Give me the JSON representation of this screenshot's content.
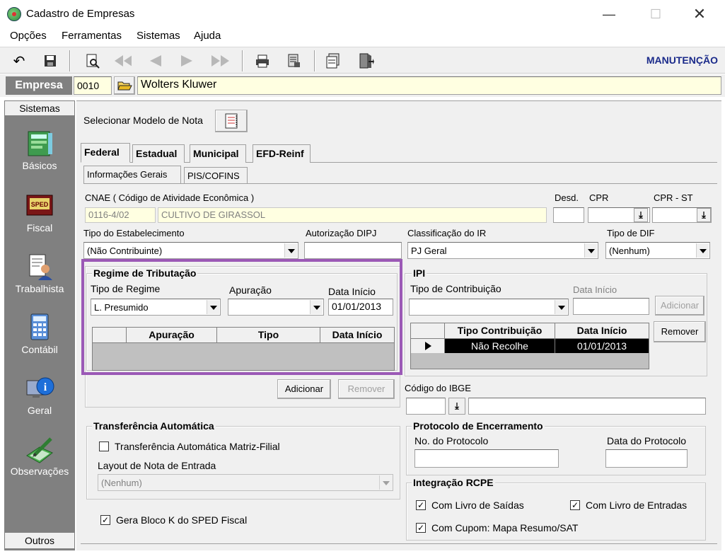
{
  "window": {
    "title": "Cadastro de Empresas"
  },
  "menu": [
    "Opções",
    "Ferramentas",
    "Sistemas",
    "Ajuda"
  ],
  "toolbar": {
    "mode": "MANUTENÇÃO"
  },
  "empresa": {
    "label": "Empresa",
    "code": "0010",
    "name": "Wolters Kluwer"
  },
  "sidebar": {
    "header": "Sistemas",
    "items": [
      {
        "label": "Básicos",
        "icon": "notebook-icon"
      },
      {
        "label": "Fiscal",
        "icon": "sped-book-icon"
      },
      {
        "label": "Trabalhista",
        "icon": "worker-document-icon"
      },
      {
        "label": "Contábil",
        "icon": "calculator-icon"
      },
      {
        "label": "Geral",
        "icon": "info-monitor-icon"
      },
      {
        "label": "Observações",
        "icon": "pencil-note-icon"
      }
    ],
    "footer": "Outros"
  },
  "modelo": {
    "label": "Selecionar Modelo de Nota"
  },
  "tabs": [
    "Federal",
    "Estadual",
    "Municipal",
    "EFD-Reinf"
  ],
  "subtabs": [
    "Informações Gerais",
    "PIS/COFINS"
  ],
  "cnae": {
    "label": "CNAE ( Código de  Atividade Econômica )",
    "code": "0116-4/02",
    "desc": "CULTIVO DE GIRASSOL"
  },
  "desd": {
    "label": "Desd."
  },
  "cpr": {
    "label": "CPR"
  },
  "cpr_st": {
    "label": "CPR - ST"
  },
  "tipo_estab": {
    "label": "Tipo do Estabelecimento",
    "value": "(Não Contribuinte)"
  },
  "aut_dipj": {
    "label": "Autorização DIPJ"
  },
  "class_ir": {
    "label": "Classificação do IR",
    "value": "PJ Geral"
  },
  "tipo_dif": {
    "label": "Tipo de DIF",
    "value": "(Nenhum)"
  },
  "regime": {
    "title": "Regime de Tributação",
    "tipo_label": "Tipo de Regime",
    "tipo_value": "L. Presumido",
    "apuracao_label": "Apuração",
    "data_label": "Data Início",
    "data_value": "01/01/2013",
    "columns": [
      "Apuração",
      "Tipo",
      "Data Início"
    ],
    "add": "Adicionar",
    "remove": "Remover"
  },
  "ipi": {
    "title": "IPI",
    "tipo_label": "Tipo de Contribuição",
    "data_label": "Data Início",
    "add": "Adicionar",
    "remove": "Remover",
    "columns": [
      "Tipo Contribuição",
      "Data Início"
    ],
    "rows": [
      {
        "tipo": "Não Recolhe",
        "data": "01/01/2013"
      }
    ]
  },
  "ibge": {
    "label": "Código do IBGE"
  },
  "transf": {
    "title": "Transferência Automática",
    "check_label": "Transferência Automática Matriz-Filial",
    "checked": false,
    "layout_label": "Layout de Nota de Entrada",
    "layout_value": "(Nenhum)"
  },
  "bloco_k": {
    "label": "Gera Bloco K do SPED Fiscal",
    "checked": true
  },
  "protocolo": {
    "title": "Protocolo de Encerramento",
    "num_label": "No. do Protocolo",
    "data_label": "Data do Protocolo"
  },
  "rcpe": {
    "title": "Integração RCPE",
    "saidas": "Com Livro de Saídas",
    "entradas": "Com Livro de Entradas",
    "cupom": "Com Cupom: Mapa Resumo/SAT"
  },
  "colors": {
    "highlight": "#9b59b6",
    "yellow": "#ffffe1",
    "grid_selected": "#000000"
  }
}
